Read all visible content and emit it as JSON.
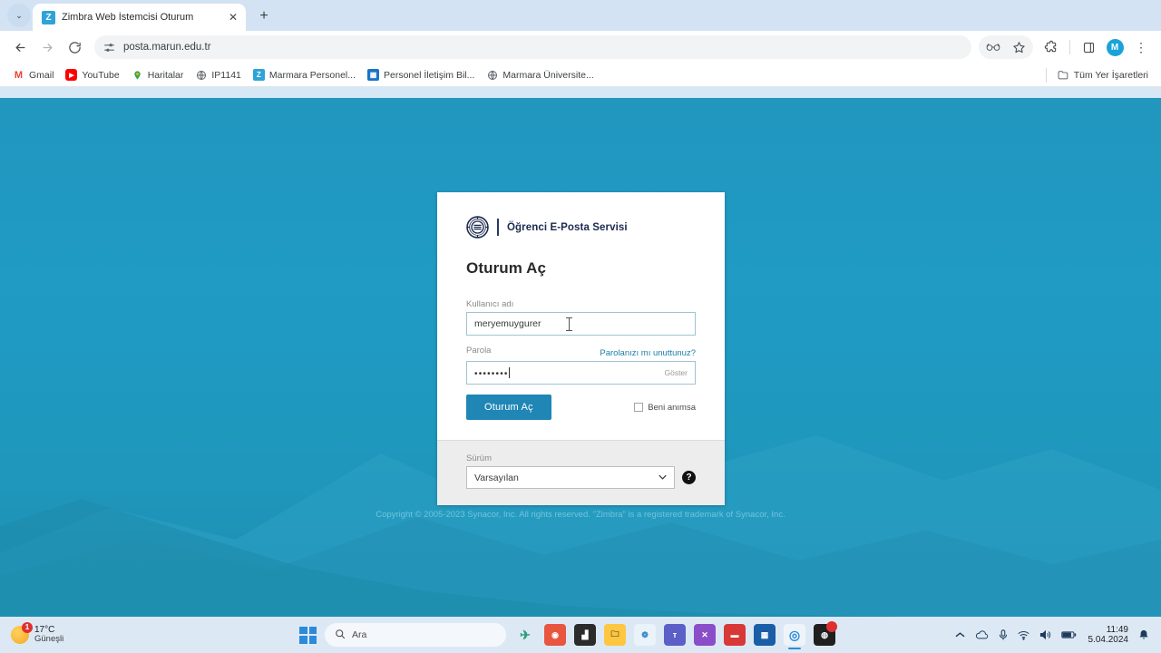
{
  "browser": {
    "tab": {
      "title": "Zimbra Web İstemcisi Oturum ",
      "favicon": "Z",
      "close_icon": "✕"
    },
    "new_tab_icon": "+",
    "tab_list_icon": "⌄",
    "nav": {
      "back_icon": "←",
      "forward_icon": "→",
      "reload_icon": "⟳"
    },
    "omnibox": {
      "url": "posta.marun.edu.tr",
      "site_icon": "tune-icon"
    },
    "toolbar_right": {
      "reading_icon": "glasses-icon",
      "bookmark_icon": "☆",
      "extensions_icon": "puzzle-icon",
      "split_icon": "split-pane-icon",
      "avatar_letter": "M",
      "menu_icon": "⋮"
    },
    "bookmarks": [
      {
        "label": "Gmail",
        "icon": "M",
        "color": "#ea4335",
        "bg": "#ffffff"
      },
      {
        "label": "YouTube",
        "icon": "▶",
        "color": "#ffffff",
        "bg": "#ff0000"
      },
      {
        "label": "Haritalar",
        "icon": "📍",
        "color": "#ffffff",
        "bg": "#ffffff"
      },
      {
        "label": "IP1141",
        "icon": "🌐",
        "color": "#ffffff",
        "bg": "#ffffff"
      },
      {
        "label": "Marmara Personel...",
        "icon": "Z",
        "color": "#ffffff",
        "bg": "#2ea3d8"
      },
      {
        "label": "Personel İletişim Bil...",
        "icon": "▦",
        "color": "#ffffff",
        "bg": "#1a73c8"
      },
      {
        "label": "Marmara Üniversite...",
        "icon": "🌐",
        "color": "#ffffff",
        "bg": "#ffffff"
      }
    ],
    "all_bookmarks": {
      "label": "Tüm Yer İşaretleri",
      "icon": "folder-icon"
    }
  },
  "login": {
    "brand": "Öğrenci E-Posta Servisi",
    "title": "Oturum Aç",
    "username_label": "Kullanıcı adı",
    "username_value": "meryemuygurer",
    "password_label": "Parola",
    "password_value": "••••••••",
    "forgot_password": "Parolanızı mı unuttunuz?",
    "show_password": "Göster",
    "signin_button": "Oturum Aç",
    "remember_label": "Beni anımsa",
    "version_label": "Sürüm",
    "version_value": "Varsayılan",
    "version_chevron": "⌄",
    "help_icon": "?",
    "copyright": "Copyright © 2005-2023 Synacor, Inc. All rights reserved. \"Zimbra\" is a registered trademark of Synacor, Inc.",
    "accent_color": "#1f86b5",
    "background_color": "#1f9bc4"
  },
  "taskbar": {
    "weather": {
      "temperature": "17°C",
      "condition": "Güneşli",
      "badge": "1"
    },
    "search_placeholder": "Ara",
    "search_icon": "⌕",
    "start_icon": "windows-logo",
    "apps": [
      {
        "name": "copilot",
        "glyph": "✈",
        "bg": "#f2f7fb",
        "color": "#2e9e7a"
      },
      {
        "name": "pixpin",
        "glyph": "◉",
        "bg": "#e8563f",
        "color": "#ffffff"
      },
      {
        "name": "powerpoint",
        "glyph": "▟",
        "bg": "#2b2b2b",
        "color": "#ffffff"
      },
      {
        "name": "file-explorer",
        "glyph": "🗀",
        "bg": "#ffc640",
        "color": "#3a3a3a"
      },
      {
        "name": "photos",
        "glyph": "❁",
        "bg": "#f0f5fa",
        "color": "#3a8fd0"
      },
      {
        "name": "teams",
        "glyph": "ᴛ",
        "bg": "#5b5fc7",
        "color": "#ffffff"
      },
      {
        "name": "visual-studio",
        "glyph": "✕",
        "bg": "#8a4ec9",
        "color": "#ffffff"
      },
      {
        "name": "media-player",
        "glyph": "▬",
        "bg": "#d93838",
        "color": "#ffffff"
      },
      {
        "name": "msi-center",
        "glyph": "▦",
        "bg": "#1a5ea8",
        "color": "#ffffff"
      },
      {
        "name": "chrome",
        "glyph": "◎",
        "bg": "#f5f8fb",
        "color": "#2d8ad8"
      },
      {
        "name": "discord",
        "glyph": "◍",
        "bg": "#1f1f1f",
        "color": "#ffffff"
      }
    ],
    "tray": {
      "chevron_icon": "⌃",
      "onedrive_icon": "☁",
      "mic_icon": "🎙",
      "wifi_icon": "◥",
      "volume_icon": "🔊",
      "battery_icon": "▭",
      "bell_icon": "🔔"
    },
    "clock": {
      "time": "11:49",
      "date": "5.04.2024"
    }
  }
}
